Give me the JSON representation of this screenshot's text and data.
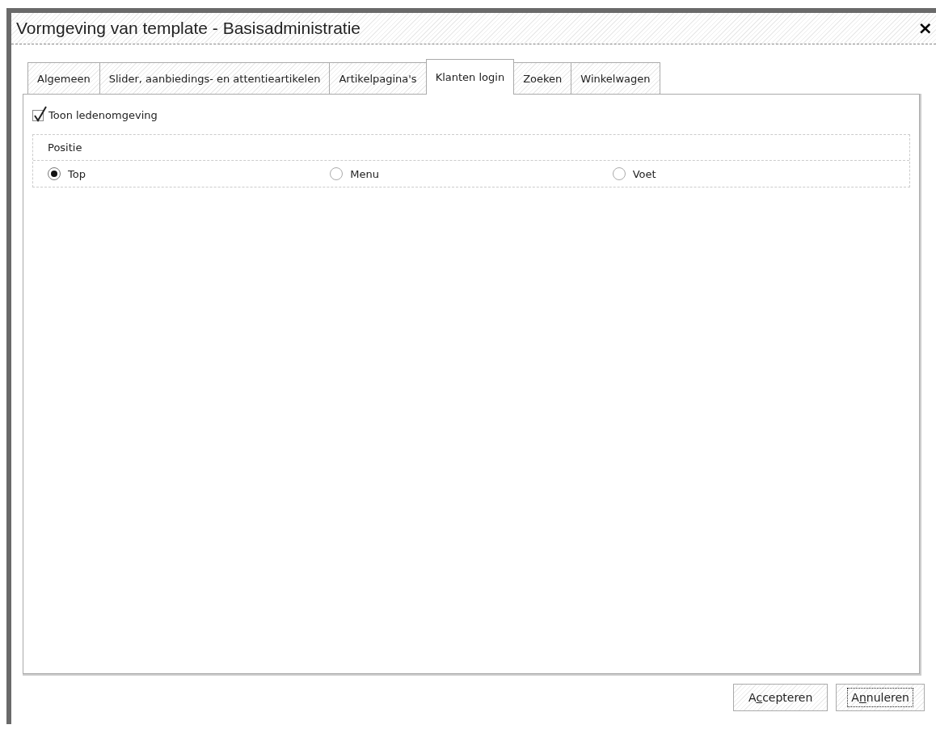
{
  "window": {
    "title": "Vormgeving van template - Basisadministratie",
    "close": "×"
  },
  "tabs": [
    {
      "label": "Algemeen",
      "selected": false
    },
    {
      "label": "Slider, aanbiedings- en attentieartikelen",
      "selected": false
    },
    {
      "label": "Artikelpagina's",
      "selected": false
    },
    {
      "label": "Klanten login",
      "selected": true
    },
    {
      "label": "Zoeken",
      "selected": false
    },
    {
      "label": "Winkelwagen",
      "selected": false
    }
  ],
  "checkbox": {
    "label": "Toon ledenomgeving",
    "checked": true
  },
  "group": {
    "title": "Positie",
    "options": [
      {
        "label": "Top",
        "selected": true
      },
      {
        "label": "Menu",
        "selected": false
      },
      {
        "label": "Voet",
        "selected": false
      }
    ]
  },
  "buttons": [
    {
      "label_before": "A",
      "access_key": "c",
      "label_after": "cepteren",
      "focused": false
    },
    {
      "label_before": "A",
      "access_key": "n",
      "label_after": "nuleren",
      "focused": true
    }
  ]
}
